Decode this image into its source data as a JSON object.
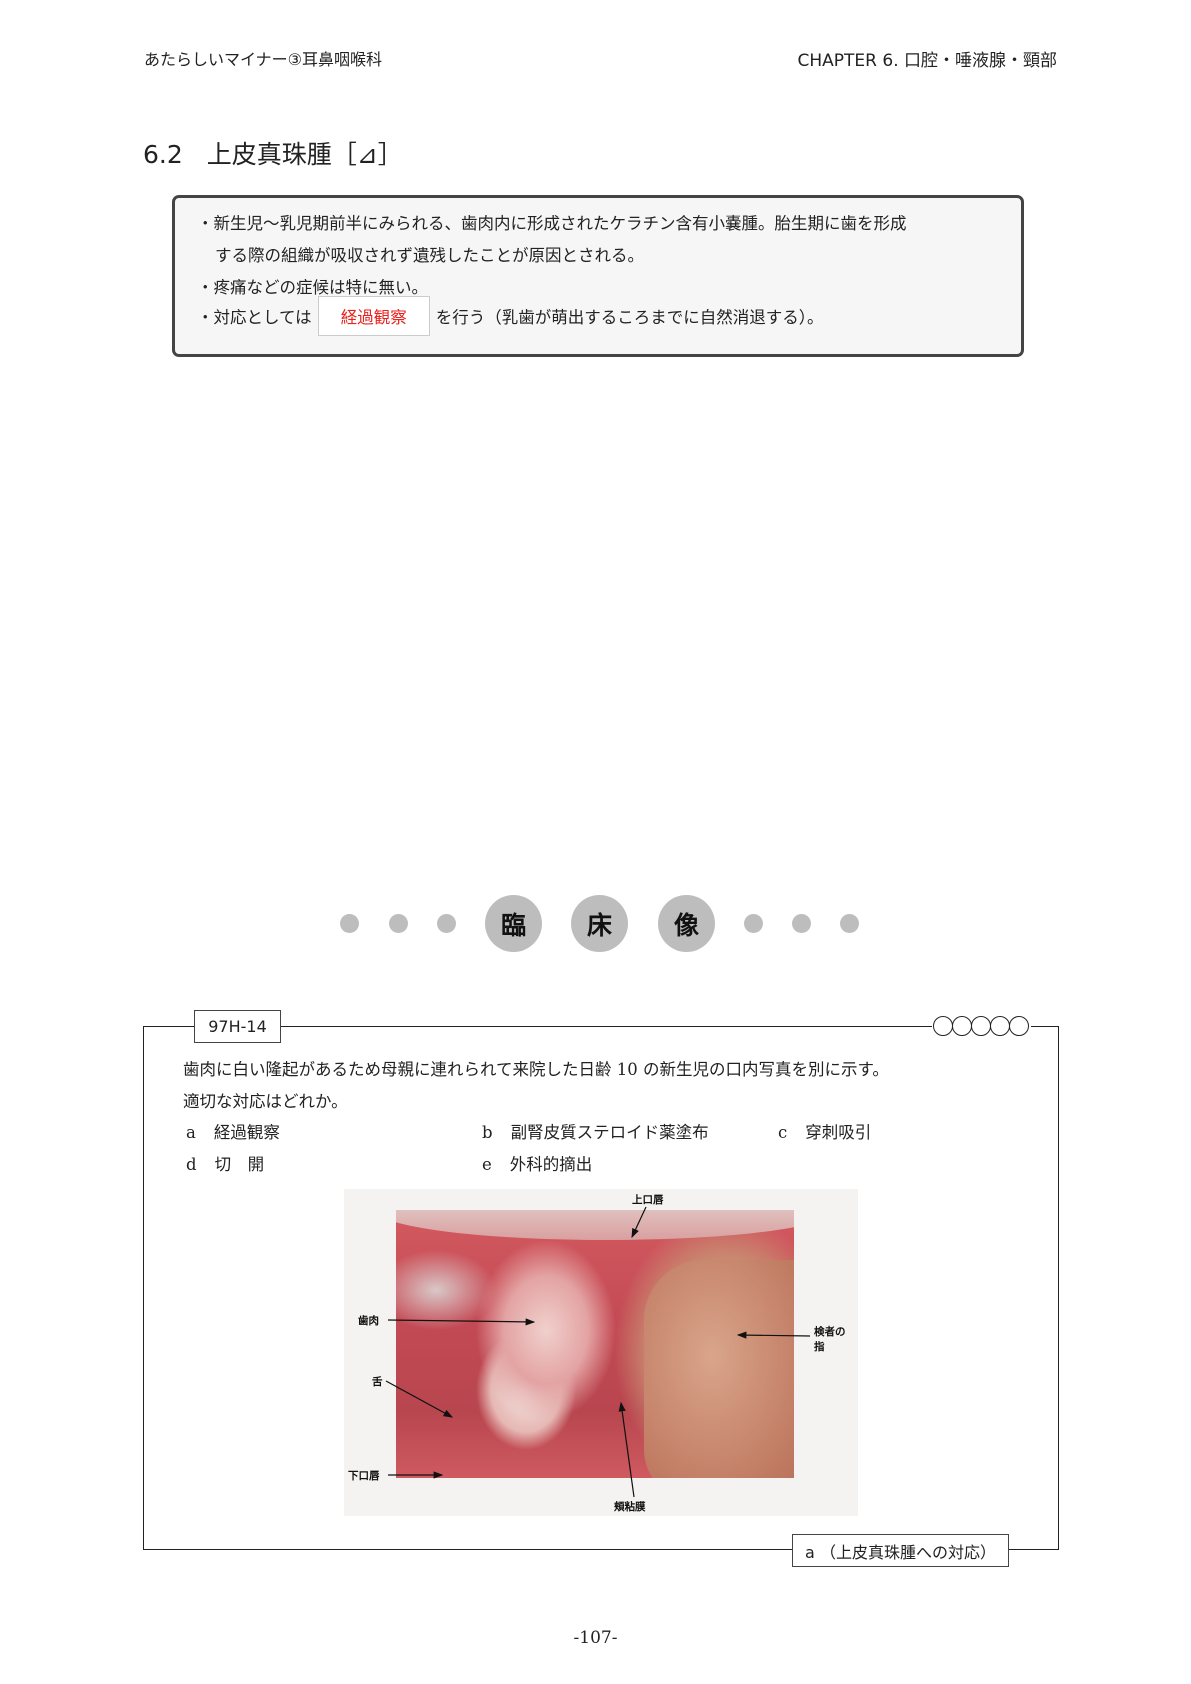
{
  "header": {
    "book": "あたらしいマイナー③耳鼻咽喉科",
    "chapter": "CHAPTER 6. 口腔・唾液腺・頸部"
  },
  "section": {
    "number": "6.2",
    "title": "上皮真珠腫［⊿］"
  },
  "summary": {
    "line1": "・新生児〜乳児期前半にみられる、歯肉内に形成されたケラチン含有小嚢腫。胎生期に歯を形成",
    "line1b": "する際の組織が吸収されず遺残したことが原因とされる。",
    "line2": "・疼痛などの症候は特に無い。",
    "line3_prefix": "・対応としては",
    "line3_blank": "経過観察",
    "line3_suffix": "を行う（乳歯が萌出するころまでに自然消退する）。",
    "blank_color": "#e8221e"
  },
  "clinical_heading": [
    "臨",
    "床",
    "像"
  ],
  "question": {
    "id": "97H-14",
    "difficulty_circles": 5,
    "stem1": "歯肉に白い隆起があるため母親に連れられて来院した日齢 10 の新生児の口内写真を別に示す。",
    "stem2": "適切な対応はどれか。",
    "options": [
      {
        "key": "a",
        "text": "経過観察"
      },
      {
        "key": "b",
        "text": "副腎皮質ステロイド薬塗布"
      },
      {
        "key": "c",
        "text": "穿刺吸引"
      },
      {
        "key": "d",
        "text": "切　開"
      },
      {
        "key": "e",
        "text": "外科的摘出"
      }
    ],
    "photo_labels": {
      "upper_lip": "上口唇",
      "gingiva": "歯肉",
      "tongue": "舌",
      "lower_lip": "下口唇",
      "examiner_finger": "検者の指",
      "buccal_mucosa": "頬粘膜"
    },
    "answer": "a （上皮真珠腫への対応）"
  },
  "page_number": "-107-"
}
